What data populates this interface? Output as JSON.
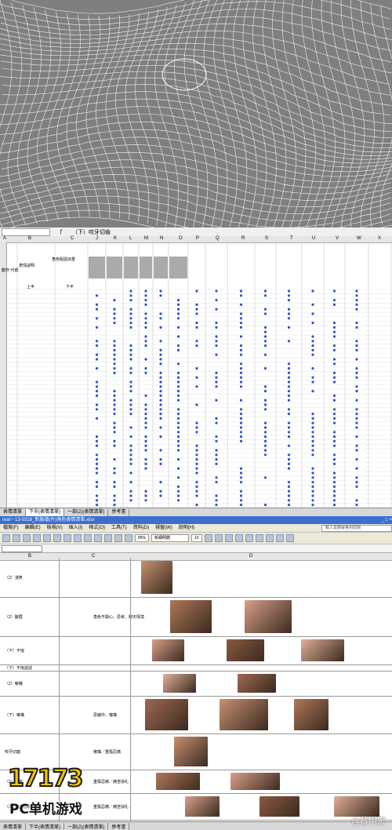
{
  "sheet1": {
    "formula_text": "（下）咬牙切齒",
    "columns": [
      "A",
      "B",
      "C",
      "J",
      "K",
      "L",
      "M",
      "N",
      "O",
      "P",
      "Q",
      "R",
      "S",
      "T",
      "U",
      "V",
      "W",
      "X"
    ],
    "header_label_left": "動作\n代號",
    "header_label_mid": "表情說明",
    "header_label_right": "角色組語派重",
    "upper": "上半",
    "lower": "下半",
    "tabs": [
      "表情清單",
      "下半(表情清單)",
      "一部(2)(表情清單)",
      "參考書"
    ]
  },
  "sheet2": {
    "title": "real－13-0318_新臉譜(片)角色表情清單.xlsx",
    "menu": [
      "檔案(F)",
      "編輯(E)",
      "檢視(V)",
      "插入(I)",
      "格式(O)",
      "工具(T)",
      "資料(D)",
      "視窗(W)",
      "說明(H)"
    ],
    "help_placeholder": "輸入需要解答的問題",
    "zoom": "85%",
    "font": "新細明體",
    "font_size": "10",
    "columns": [
      "B",
      "C",
      "D"
    ],
    "rows": [
      {
        "label": "（2）淺笑",
        "desc": ""
      },
      {
        "label": "（2）皺眉",
        "desc": "角色不開心、思考、聊天情境"
      },
      {
        "label": "（下）不悅",
        "desc": ""
      },
      {
        "label": "（下）不悅說話",
        "desc": ""
      },
      {
        "label": "（2）嘟嘴",
        "desc": ""
      },
      {
        "label": "（下）嘟嘴",
        "desc": "思緒中、嘟嘴"
      },
      {
        "label": "咬牙切齒",
        "desc": "嘟嘴／重傷忍痛"
      },
      {
        "label": "（2）痛苦",
        "desc": "重傷忍痛／痛苦掙扎"
      },
      {
        "label": "（2）痛苦瞇眼",
        "desc": "重傷忍痛／痛苦掙扎"
      },
      {
        "label": "",
        "desc": ""
      }
    ],
    "tabs": [
      "表情清單",
      "下半(表情清單)",
      "一部(2)(表情清單)",
      "參考書"
    ]
  },
  "branding": {
    "logo_number": "17173",
    "logo_text": "PC单机游戏",
    "watermark": "@蔡明宏"
  }
}
